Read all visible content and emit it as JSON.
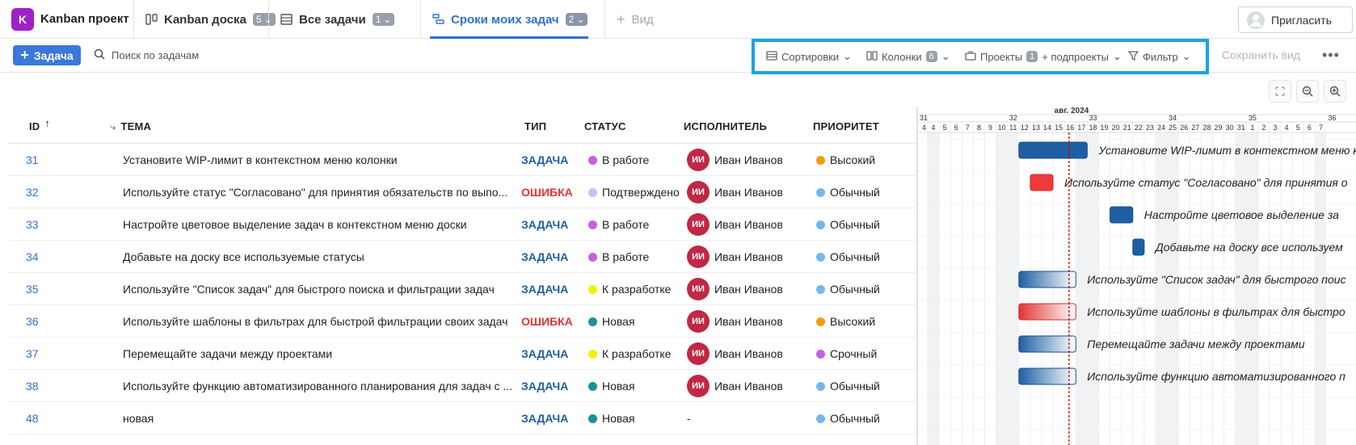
{
  "app": {
    "logo_letter": "K",
    "project_name": "Kanban проект"
  },
  "view_tabs": [
    {
      "label": "Kanban доска",
      "count": "5",
      "icon": "kanban-icon",
      "active": false
    },
    {
      "label": "Все задачи",
      "count": "1",
      "icon": "list-icon",
      "active": false
    },
    {
      "label": "Сроки моих задач",
      "count": "2",
      "icon": "gantt-icon",
      "active": true
    }
  ],
  "add_view_label": "Вид",
  "invite_label": "Пригласить",
  "toolbar": {
    "add_task_label": "Задача",
    "search_placeholder": "Поиск по задачам",
    "sort_label": "Сортировки",
    "columns_label": "Колонки",
    "columns_count": "6",
    "projects_label": "Проекты",
    "projects_count": "1",
    "subprojects_label": "+ подпроекты",
    "filter_label": "Фильтр",
    "save_view_label": "Сохранить вид",
    "more_label": "•••"
  },
  "columns": {
    "id": "ID",
    "title": "ТЕМА",
    "type": "ТИП",
    "status": "СТАТУС",
    "assignee": "ИСПОЛНИТЕЛЬ",
    "priority": "ПРИОРИТЕТ"
  },
  "colors": {
    "task": "#1e5fa3",
    "bug": "#e03535",
    "accent": "#2f6fd6"
  },
  "tasks": [
    {
      "id": "31",
      "title": "Установите WIP-лимит в контекстном меню колонки",
      "type": "ЗАДАЧА",
      "status": "В работе",
      "status_color": "#c660e0",
      "initials": "ИИ",
      "assignee": "Иван Иванов",
      "priority": "Высокий",
      "priority_color": "#f39c12"
    },
    {
      "id": "32",
      "title": "Используйте статус \"Согласовано\" для принятия обязательств по выпо...",
      "type": "ОШИБКА",
      "status": "Подтверждено",
      "status_color": "#d5b8f5",
      "initials": "ИИ",
      "assignee": "Иван Иванов",
      "priority": "Обычный",
      "priority_color": "#74b7f0"
    },
    {
      "id": "33",
      "title": "Настройте цветовое выделение задач в контекстном меню доски",
      "type": "ЗАДАЧА",
      "status": "В работе",
      "status_color": "#c660e0",
      "initials": "ИИ",
      "assignee": "Иван Иванов",
      "priority": "Обычный",
      "priority_color": "#74b7f0"
    },
    {
      "id": "34",
      "title": "Добавьте на доску все используемые статусы",
      "type": "ЗАДАЧА",
      "status": "В работе",
      "status_color": "#c660e0",
      "initials": "ИИ",
      "assignee": "Иван Иванов",
      "priority": "Обычный",
      "priority_color": "#74b7f0"
    },
    {
      "id": "35",
      "title": "Используйте \"Список задач\" для быстрого поиска и фильтрации задач",
      "type": "ЗАДАЧА",
      "status": "К разработке",
      "status_color": "#f2f200",
      "initials": "ИИ",
      "assignee": "Иван Иванов",
      "priority": "Обычный",
      "priority_color": "#74b7f0"
    },
    {
      "id": "36",
      "title": "Используйте шаблоны в фильтрах для быстрой фильтрации своих задач",
      "type": "ОШИБКА",
      "status": "Новая",
      "status_color": "#17929a",
      "initials": "ИИ",
      "assignee": "Иван Иванов",
      "priority": "Высокий",
      "priority_color": "#f39c12"
    },
    {
      "id": "37",
      "title": "Перемещайте задачи между проектами",
      "type": "ЗАДАЧА",
      "status": "К разработке",
      "status_color": "#f2f200",
      "initials": "ИИ",
      "assignee": "Иван Иванов",
      "priority": "Срочный",
      "priority_color": "#c660e0"
    },
    {
      "id": "38",
      "title": "Используйте функцию автоматизированного планирования для задач с ...",
      "type": "ЗАДАЧА",
      "status": "Новая",
      "status_color": "#17929a",
      "initials": "ИИ",
      "assignee": "Иван Иванов",
      "priority": "Обычный",
      "priority_color": "#74b7f0"
    },
    {
      "id": "48",
      "title": "новая",
      "type": "ЗАДАЧА",
      "status": "Новая",
      "status_color": "#17929a",
      "initials": "",
      "assignee": "-",
      "priority": "Обычный",
      "priority_color": "#74b7f0"
    }
  ],
  "gantt": {
    "month_label": "авг. 2024",
    "weeks": [
      "31",
      "32",
      "33",
      "34",
      "35",
      "36"
    ],
    "days": [
      "4",
      "5",
      "6",
      "7",
      "8",
      "9",
      "10",
      "11",
      "12",
      "13",
      "14",
      "15",
      "16",
      "17",
      "18",
      "19",
      "20",
      "21",
      "22",
      "23",
      "24",
      "25",
      "26",
      "27",
      "28",
      "29",
      "30",
      "31",
      "1",
      "2",
      "3",
      "4",
      "5",
      "6",
      "7"
    ],
    "today_index": 12.4,
    "bars": [
      {
        "label": "Установите WIP-лимит в контекстном меню колонки",
        "start": 8,
        "span": 6,
        "kind": "task",
        "style": "solid"
      },
      {
        "label": "Используйте статус \"Согласовано\" для принятия о",
        "start": 9,
        "span": 2,
        "kind": "bug",
        "style": "solid"
      },
      {
        "label": "Настройте цветовое выделение за",
        "start": 16,
        "span": 2,
        "kind": "task",
        "style": "solid"
      },
      {
        "label": "Добавьте на доску все используем",
        "start": 18,
        "span": 1,
        "kind": "task",
        "style": "solid"
      },
      {
        "label": "Используйте \"Список задач\" для быстрого поис",
        "start": 8,
        "span": 5,
        "kind": "task",
        "style": "fade"
      },
      {
        "label": "Используйте шаблоны в фильтрах для быстро",
        "start": 8,
        "span": 5,
        "kind": "bug",
        "style": "fade"
      },
      {
        "label": "Перемещайте задачи между проектами",
        "start": 8,
        "span": 5,
        "kind": "task",
        "style": "fade"
      },
      {
        "label": "Используйте функцию автоматизированного п",
        "start": 8,
        "span": 5,
        "kind": "task",
        "style": "fade"
      }
    ]
  }
}
